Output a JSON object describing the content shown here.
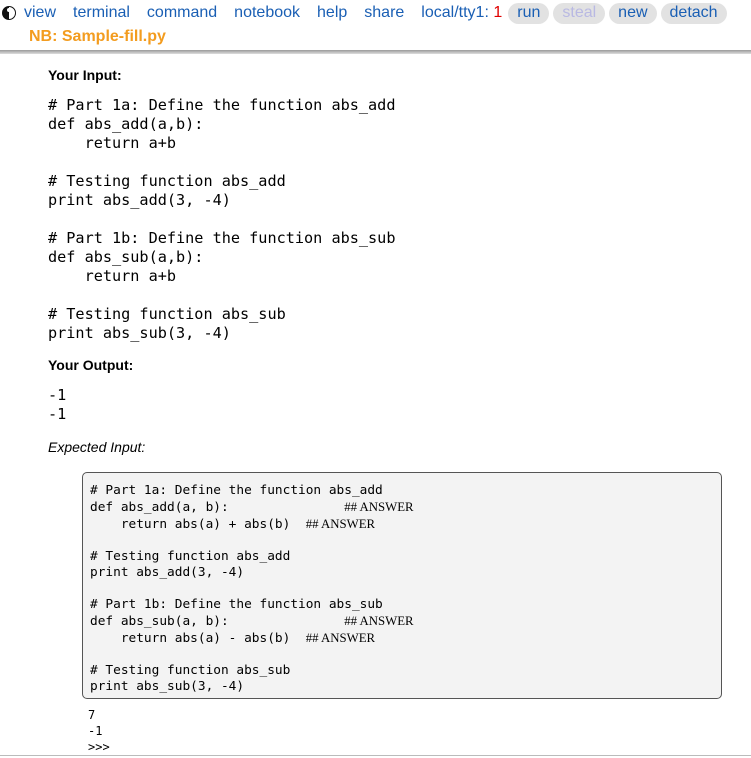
{
  "topbar": {
    "links": [
      "view",
      "terminal",
      "command",
      "notebook",
      "help",
      "share"
    ],
    "tty_label": "local/tty1:",
    "tty_num": "1",
    "buttons": [
      {
        "label": "run",
        "disabled": false
      },
      {
        "label": "steal",
        "disabled": true
      },
      {
        "label": "new",
        "disabled": false
      },
      {
        "label": "detach",
        "disabled": false
      }
    ]
  },
  "notebook": {
    "title": "NB: Sample-fill.py"
  },
  "input": {
    "label": "Your Input:",
    "lines": [
      "# Part 1a: Define the function abs_add",
      "def abs_add(a,b):",
      "    return a+b",
      "",
      "# Testing function abs_add",
      "print abs_add(3, -4)",
      "",
      "# Part 1b: Define the function abs_sub",
      "def abs_sub(a,b):",
      "    return a+b",
      "",
      "# Testing function abs_sub",
      "print abs_sub(3, -4)"
    ]
  },
  "output": {
    "label": "Your Output:",
    "lines": [
      "-1",
      "-1"
    ]
  },
  "expected": {
    "label": "Expected Input:",
    "lines": [
      {
        "code": "# Part 1a: Define the function abs_add",
        "ann": ""
      },
      {
        "code": "def abs_add(a, b):               ",
        "ann": "## ANSWER"
      },
      {
        "code": "    return abs(a) + abs(b)  ",
        "ann": "## ANSWER"
      },
      {
        "code": "",
        "ann": ""
      },
      {
        "code": "# Testing function abs_add",
        "ann": ""
      },
      {
        "code": "print abs_add(3, -4)",
        "ann": ""
      },
      {
        "code": "",
        "ann": ""
      },
      {
        "code": "# Part 1b: Define the function abs_sub",
        "ann": ""
      },
      {
        "code": "def abs_sub(a, b):               ",
        "ann": "## ANSWER"
      },
      {
        "code": "    return abs(a) - abs(b)  ",
        "ann": "## ANSWER"
      },
      {
        "code": "",
        "ann": ""
      },
      {
        "code": "# Testing function abs_sub",
        "ann": ""
      },
      {
        "code": "print abs_sub(3, -4)",
        "ann": ""
      }
    ]
  },
  "console": {
    "lines": [
      "7",
      "-1",
      ">>>"
    ]
  }
}
